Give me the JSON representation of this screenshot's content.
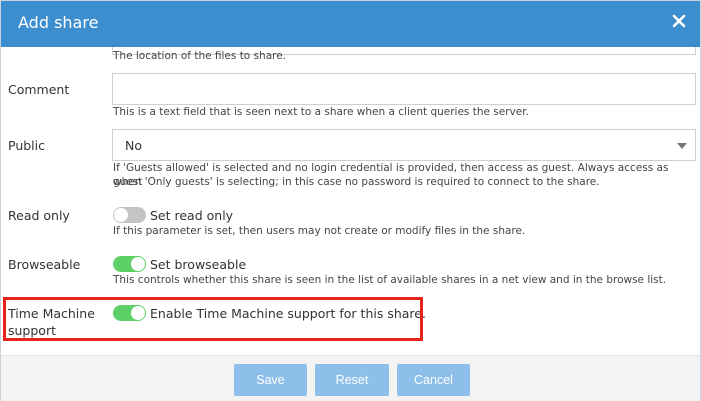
{
  "dialog": {
    "title": "Add share",
    "close_icon": "close-icon"
  },
  "fields": {
    "path_hint": "The location of the files to share.",
    "comment_label": "Comment",
    "comment_value": "",
    "comment_hint": "This is a text field that is seen next to a share when a client queries the server.",
    "public_label": "Public",
    "public_value": "No",
    "public_hint_line1": "If 'Guests allowed' is selected and no login credential is provided, then access as guest. Always access as guest",
    "public_hint_line2": "when 'Only guests' is selecting; in this case no password is required to connect to the share.",
    "readonly_label": "Read only",
    "readonly_toggle_text": "Set read only",
    "readonly_enabled": false,
    "readonly_hint": "If this parameter is set, then users may not create or modify files in the share.",
    "browseable_label": "Browseable",
    "browseable_toggle_text": "Set browseable",
    "browseable_enabled": true,
    "browseable_hint": "This controls whether this share is seen in the list of available shares in a net view and in the browse list.",
    "timemachine_label_line1": "Time Machine",
    "timemachine_label_line2": "support",
    "timemachine_toggle_text": "Enable Time Machine support for this share.",
    "timemachine_enabled": true
  },
  "footer": {
    "save_label": "Save",
    "reset_label": "Reset",
    "cancel_label": "Cancel"
  },
  "colors": {
    "titlebar": "#3d8ecf",
    "toggle_on": "#5dd068",
    "toggle_off": "#c4c4c4",
    "button": "#8dbfea",
    "highlight": "#e8231a"
  }
}
